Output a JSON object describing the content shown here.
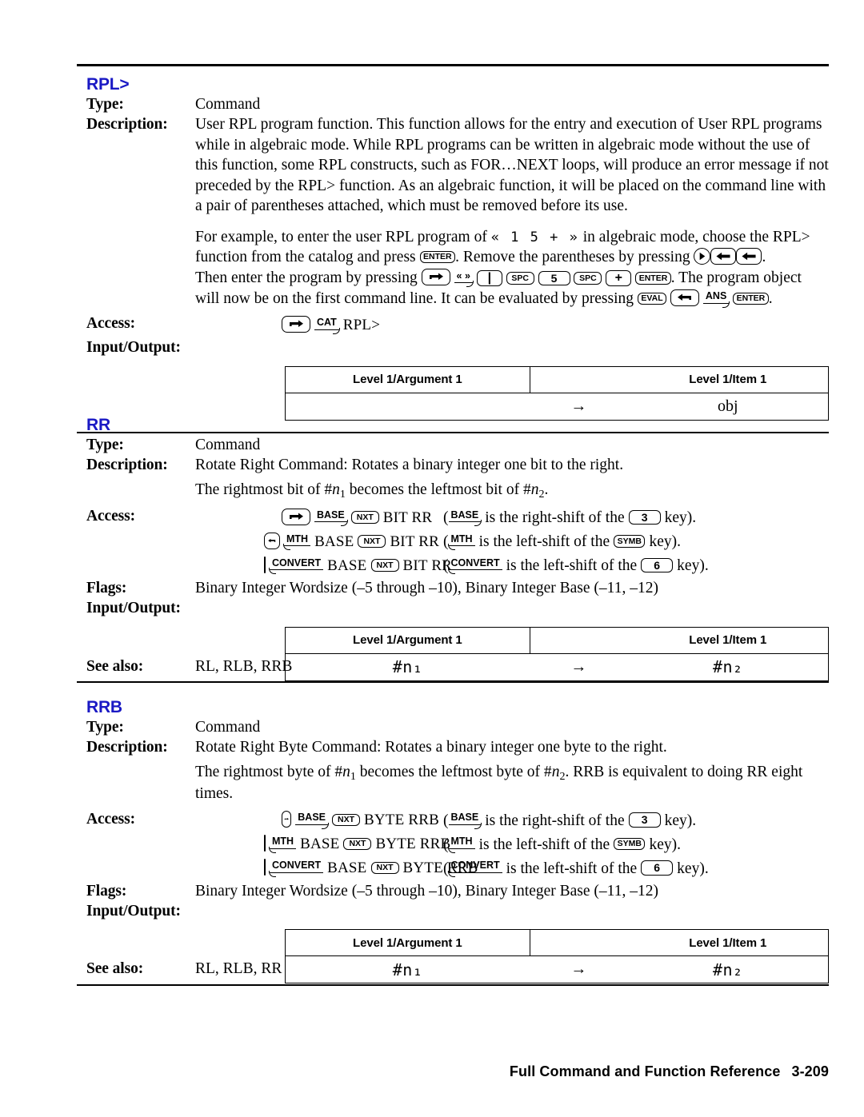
{
  "labels": {
    "type": "Type:",
    "description": "Description:",
    "access": "Access:",
    "flags": "Flags:",
    "input_output": "Input/Output:",
    "see_also": "See also:"
  },
  "table_headers": {
    "argument": "Level 1/Argument 1",
    "item": "Level 1/Item 1",
    "arrow": "→"
  },
  "heading_color": "#1a19c4",
  "entries": [
    {
      "name": "RPL>",
      "type": "Command",
      "description_paras": [
        "User RPL program function. This function allows for the entry and execution of User RPL programs while in algebraic mode. While RPL programs can be written in algebraic mode without the use of this function, some RPL constructs, such as FOR…NEXT loops, will produce an error message if not preceded by the RPL> function. As an algebraic function, it will be placed on the command line with a pair of parentheses attached, which must be removed before its use."
      ],
      "example": {
        "seg1": "For example, to enter the user RPL program of",
        "program": "« 1 5 + »",
        "seg2": "in algebraic mode, choose the RPL> function from the catalog and press",
        "key_enter": "ENTER",
        "seg3": ". Remove the parentheses by pressing",
        "seg4": ".",
        "seg5": "Then enter the program by pressing",
        "key_prog_delim": "« »",
        "key_pipe": "|",
        "key_spc": "SPC",
        "key_5": "5",
        "key_plus": "+",
        "seg6": ". The program object will now be on the first command line. It can be evaluated by pressing",
        "key_eval": "EVAL",
        "key_ans": "ANS",
        "seg7": "."
      },
      "access_lines": [
        {
          "shift": "right",
          "menu_label": "CAT",
          "hook": "right",
          "path": "RPL>",
          "note": null
        }
      ],
      "flags": null,
      "io": {
        "argument": "",
        "item": "obj"
      },
      "see_also": null
    },
    {
      "name": "RR",
      "type": "Command",
      "description_paras": [
        "Rotate Right Command: Rotates a binary integer one bit to the right.",
        "The rightmost bit of #n₁ becomes the leftmost bit of #n₂."
      ],
      "description_line2": {
        "pre": "The rightmost bit of #",
        "var1": "n",
        "sub1": "1",
        "mid": " becomes the leftmost bit of #",
        "var2": "n",
        "sub2": "2",
        "post": "."
      },
      "access_lines": [
        {
          "shift": "right",
          "menu_label": "BASE",
          "hook": "right",
          "nxt": "NXT",
          "path": "BIT RR",
          "note_pre": "(",
          "note_label": "BASE",
          "note_mid": "is the right-shift of the",
          "note_key": "3",
          "note_post": "key)."
        },
        {
          "shift": "left",
          "menu_label": "MTH",
          "hook": "left",
          "pre_path": "BASE",
          "nxt": "NXT",
          "path": "BIT RR",
          "note_pre": "(",
          "note_label": "MTH",
          "note_mid": "is the left-shift of the",
          "note_key": "SYMB",
          "note_post": "key)."
        },
        {
          "shift": "left",
          "menu_label": "CONVERT",
          "hook": "left",
          "pre_path": "BASE",
          "nxt": "NXT",
          "path": "BIT RR",
          "note_pre": "(",
          "note_label": "CONVERT",
          "note_mid": "is the left-shift of the",
          "note_key": "6",
          "note_post": "key)."
        }
      ],
      "flags": "Binary Integer Wordsize (–5 through –10), Binary Integer Base (–11, –12)",
      "io": {
        "argument": "#n₁",
        "item": "#n₂"
      },
      "see_also": "RL, RLB, RRB"
    },
    {
      "name": "RRB",
      "type": "Command",
      "description_paras": [
        "Rotate Right Byte Command: Rotates a binary integer one byte to the right.",
        "The rightmost byte of #n₁ becomes the leftmost byte of #n₂. RRB is equivalent to doing RR eight times."
      ],
      "description_line2": {
        "pre": "The rightmost byte of #",
        "var1": "n",
        "sub1": "1",
        "mid": " becomes the leftmost byte of #",
        "var2": "n",
        "sub2": "2",
        "post": ". RRB is equivalent to doing RR eight times."
      },
      "access_lines": [
        {
          "shift": "right",
          "menu_label": "BASE",
          "hook": "right",
          "nxt": "NXT",
          "path": "BYTE RRB",
          "note_pre": "(",
          "note_label": "BASE",
          "note_mid": "is the right-shift of the",
          "note_key": "3",
          "note_post": "key)."
        },
        {
          "shift": "left",
          "menu_label": "MTH",
          "hook": "left",
          "pre_path": "BASE",
          "nxt": "NXT",
          "path": "BYTE RRB",
          "note_pre": "(",
          "note_label": "MTH",
          "note_mid": "is the left-shift of the",
          "note_key": "SYMB",
          "note_post": "key)."
        },
        {
          "shift": "left",
          "menu_label": "CONVERT",
          "hook": "left",
          "pre_path": "BASE",
          "nxt": "NXT",
          "path": "BYTE RRB",
          "note_pre": "(",
          "note_label": "CONVERT",
          "note_mid": "is the left-shift of the",
          "note_key": "6",
          "note_post": "key)."
        }
      ],
      "flags": "Binary Integer Wordsize (–5 through –10), Binary Integer Base (–11, –12)",
      "io": {
        "argument": "#n₁",
        "item": "#n₂"
      },
      "see_also": "RL, RLB, RR"
    }
  ],
  "footer": {
    "title": "Full Command and Function Reference",
    "page": "3-209"
  }
}
